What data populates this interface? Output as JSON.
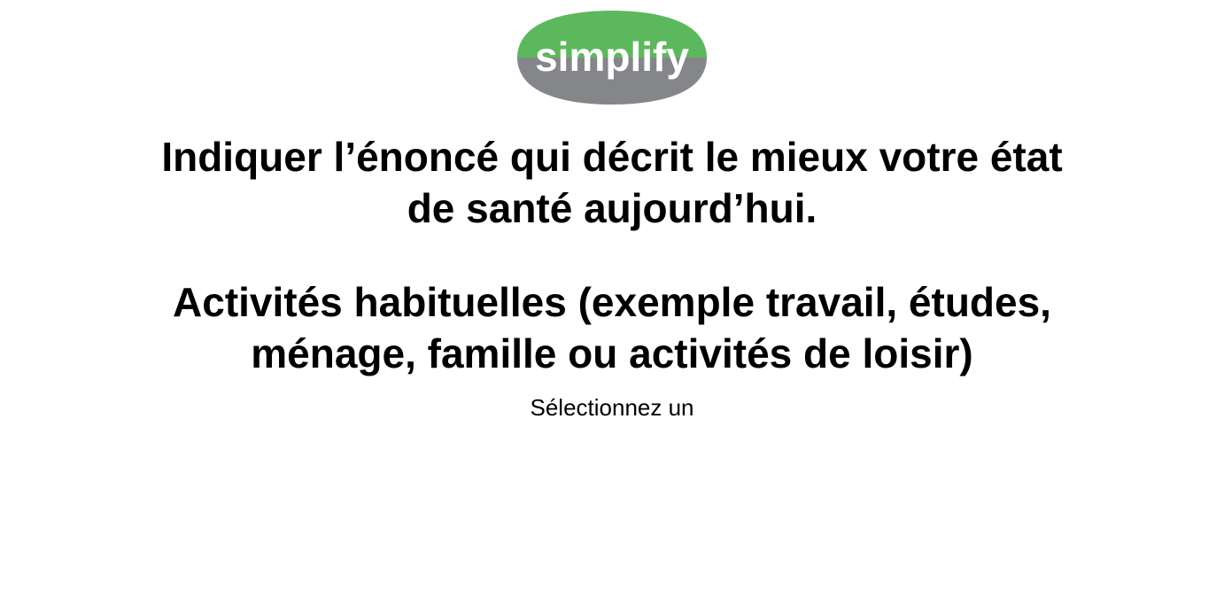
{
  "logo": {
    "text": "simplify",
    "colors": {
      "top": "#5cb85c",
      "bottom": "#858689",
      "text": "#ffffff"
    }
  },
  "question": {
    "line1": "Indiquer l’énoncé qui décrit le mieux votre état",
    "line2": "de santé aujourd’hui."
  },
  "category": {
    "line1": "Activités habituelles (exemple travail, études,",
    "line2": "ménage, famille ou activités de loisir)"
  },
  "instruction": "Sélectionnez un"
}
